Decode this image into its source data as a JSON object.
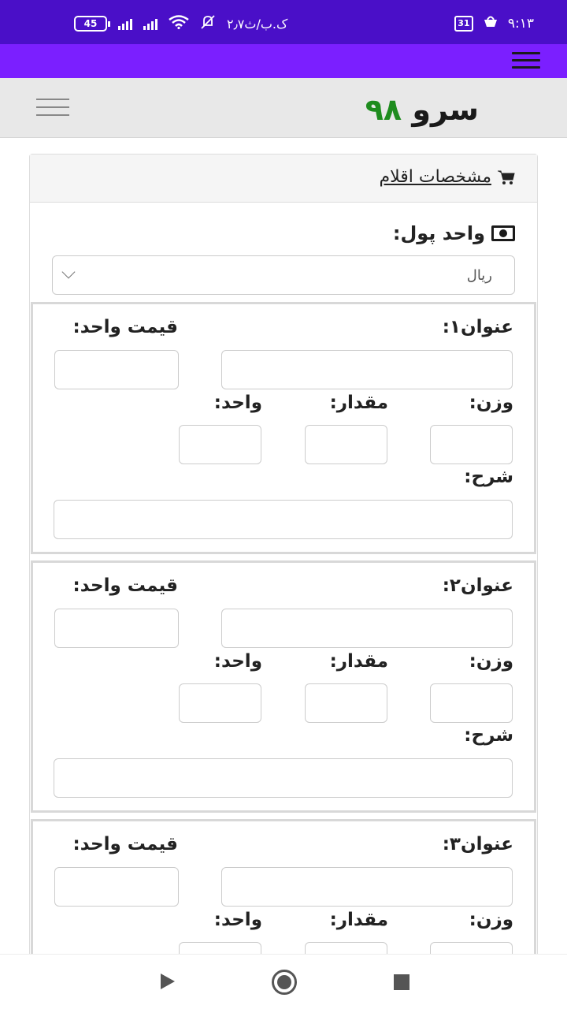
{
  "status_bar": {
    "time": "۹:۱۳",
    "calendar_day": "31",
    "speed": "۲٫۷ک.ب/ث",
    "battery": "45"
  },
  "site": {
    "logo_text": "سرو",
    "logo_number": "۹۸"
  },
  "panel": {
    "title": "مشخصات اقلام",
    "currency_label": "واحد پول:",
    "currency_value": "ریال"
  },
  "items": [
    {
      "title_label": "عنوان۱:",
      "price_label": "قیمت واحد:",
      "weight_label": "وزن:",
      "amount_label": "مقدار:",
      "unit_label": "واحد:",
      "desc_label": "شرح:"
    },
    {
      "title_label": "عنوان۲:",
      "price_label": "قیمت واحد:",
      "weight_label": "وزن:",
      "amount_label": "مقدار:",
      "unit_label": "واحد:",
      "desc_label": "شرح:"
    },
    {
      "title_label": "عنوان۳:",
      "price_label": "قیمت واحد:",
      "weight_label": "وزن:",
      "amount_label": "مقدار:",
      "unit_label": "واحد:"
    }
  ],
  "icons": {
    "menu": "hamburger-icon",
    "cart": "cart-icon",
    "money": "money-icon"
  },
  "colors": {
    "status_bar": "#4a0fc8",
    "app_bar": "#7b1fff",
    "logo_number": "#1e8c1e"
  }
}
